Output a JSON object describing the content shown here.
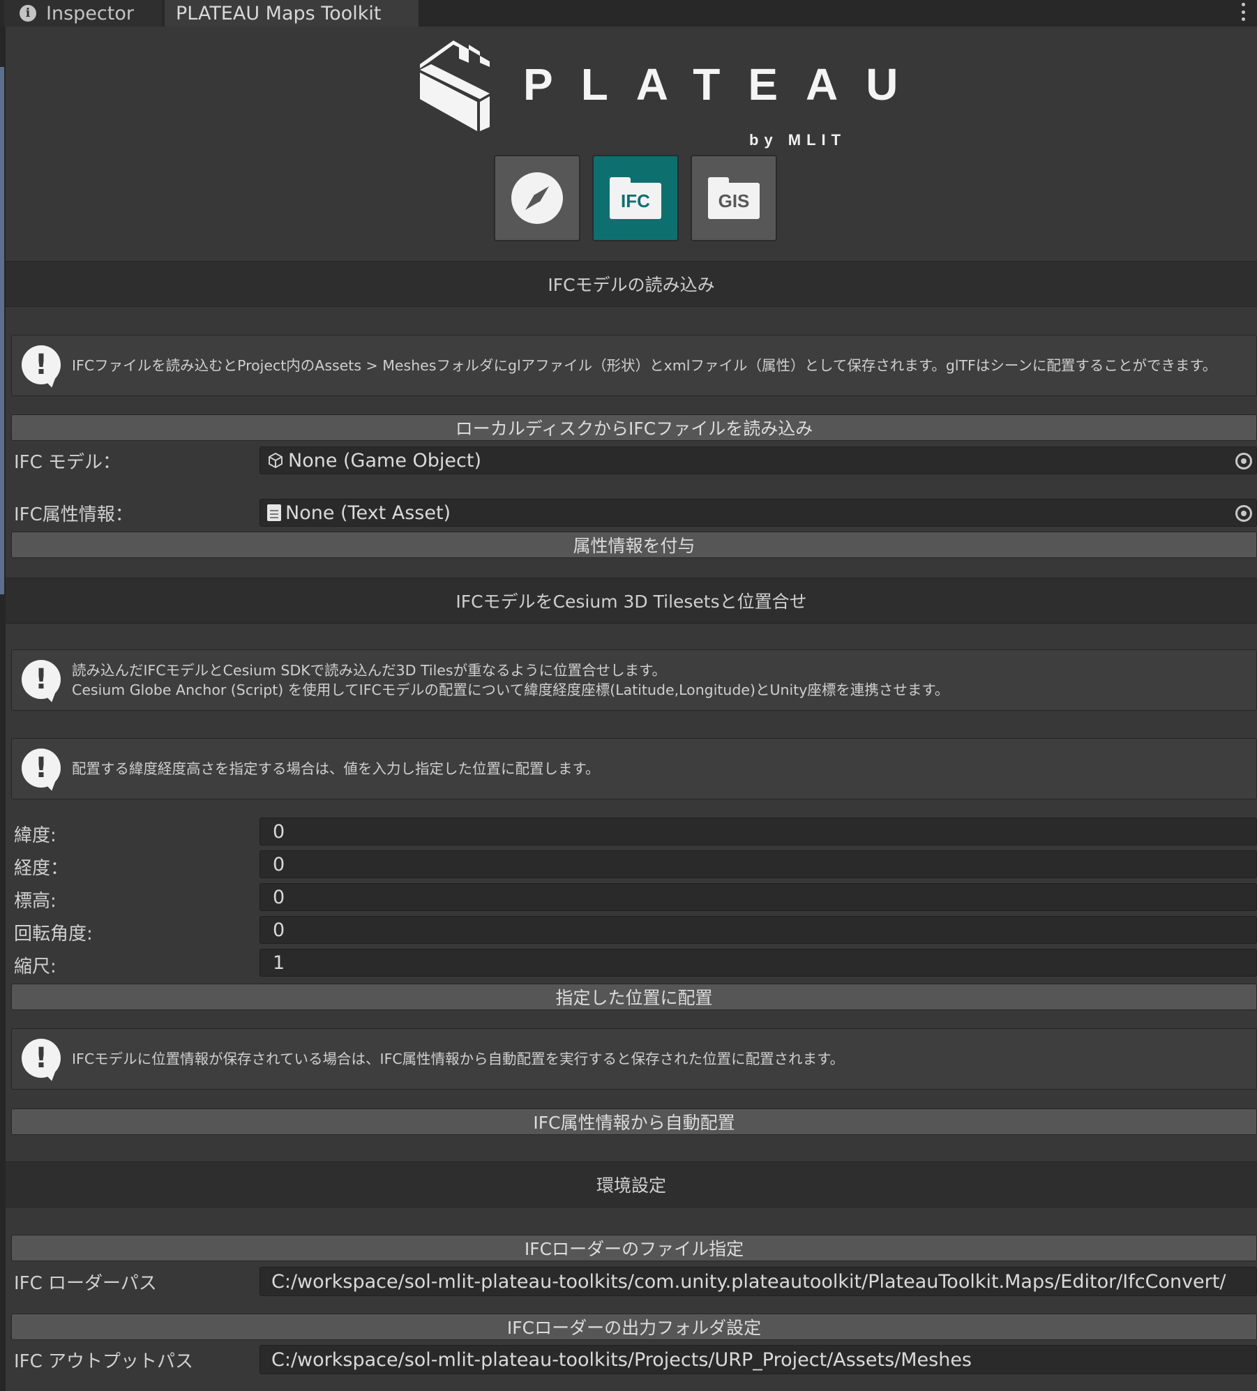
{
  "tabs": {
    "inspector": "Inspector",
    "plateau": "PLATEAU Maps Toolkit"
  },
  "logo": {
    "word": "PLATEAU",
    "sub": "by MLIT"
  },
  "modes": {
    "ifc_label": "IFC",
    "gis_label": "GIS",
    "active": "IFC"
  },
  "section_load": {
    "title": "IFCモデルの読み込み",
    "help": "IFCファイルを読み込むとProject内のAssets > Meshesフォルダにglアファイル（形状）とxmlファイル（属性）として保存されます。glTFはシーンに配置することができます。",
    "load_button": "ローカルディスクからIFCファイルを読み込み",
    "model_label": "IFC モデル：",
    "model_value": "None (Game Object)",
    "attr_label": "IFC属性情報：",
    "attr_value": "None (Text Asset)",
    "assign_button": "属性情報を付与"
  },
  "section_align": {
    "title": "IFCモデルをCesium 3D Tilesetsと位置合せ",
    "help1_line1": "読み込んだIFCモデルとCesium SDKで読み込んだ3D Tilesが重なるように位置合せします。",
    "help1_line2": "Cesium Globe Anchor (Script) を使用してIFCモデルの配置について緯度経度座標(Latitude,Longitude)とUnity座標を連携させます。",
    "help2": "配置する緯度経度高さを指定する場合は、値を入力し指定した位置に配置します。",
    "lat_label": "緯度:",
    "lat_value": "0",
    "lon_label": "経度：",
    "lon_value": "0",
    "alt_label": "標高:",
    "alt_value": "0",
    "rot_label": "回転角度:",
    "rot_value": "0",
    "scale_label": "縮尺:",
    "scale_value": "1",
    "place_button": "指定した位置に配置",
    "help3": "IFCモデルに位置情報が保存されている場合は、IFC属性情報から自動配置を実行すると保存された位置に配置されます。",
    "auto_button": "IFC属性情報から自動配置"
  },
  "section_env": {
    "title": "環境設定",
    "loader_header": "IFCローダーのファイル指定",
    "loader_label": "IFC ローダーパス",
    "loader_value": "C:/workspace/sol-mlit-plateau-toolkits/com.unity.plateautoolkit/PlateauToolkit.Maps/Editor/IfcConvert/",
    "output_header": "IFCローダーの出力フォルダ設定",
    "output_label": "IFC アウトプットパス",
    "output_value": "C:/workspace/sol-mlit-plateau-toolkits/Projects/URP_Project/Assets/Meshes"
  }
}
